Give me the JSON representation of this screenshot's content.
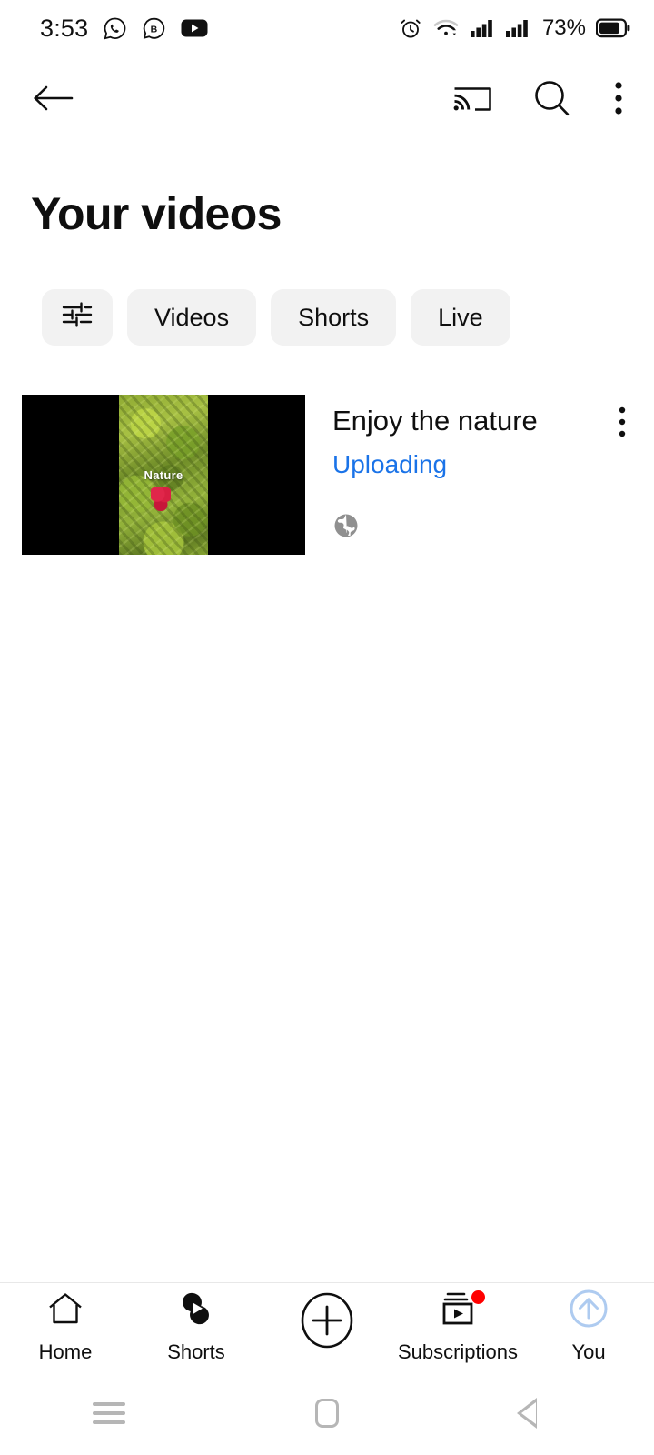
{
  "status_bar": {
    "time": "3:53",
    "left_icons": [
      "whatsapp-icon",
      "b-messenger-icon",
      "youtube-icon"
    ],
    "right_icons": [
      "alarm-icon",
      "wifi-icon",
      "signal-1-icon",
      "signal-2-icon"
    ],
    "battery_percent": "73%"
  },
  "header": {
    "back_icon": "back-arrow-icon",
    "cast_icon": "cast-icon",
    "search_icon": "search-icon",
    "overflow_icon": "more-vertical-icon",
    "title": "Your videos"
  },
  "filters": {
    "filter_icon": "tune-sliders-icon",
    "chips": [
      {
        "label": "Videos",
        "selected": false
      },
      {
        "label": "Shorts",
        "selected": false
      },
      {
        "label": "Live",
        "selected": false
      }
    ]
  },
  "videos": [
    {
      "title": "Enjoy the nature",
      "status": "Uploading",
      "status_color": "#1a73e8",
      "visibility": "public",
      "visibility_icon": "globe-icon",
      "thumbnail_overlay_text": "Nature",
      "menu_icon": "more-vertical-icon"
    }
  ],
  "bottom_nav": [
    {
      "label": "Home",
      "icon": "home-icon",
      "badge": false,
      "active": false
    },
    {
      "label": "Shorts",
      "icon": "shorts-icon",
      "badge": false,
      "active": false
    },
    {
      "label": "",
      "icon": "create-plus-icon",
      "badge": false,
      "active": false
    },
    {
      "label": "Subscriptions",
      "icon": "subscriptions-icon",
      "badge": true,
      "active": false
    },
    {
      "label": "You",
      "icon": "upload-progress-icon",
      "badge": false,
      "active": true
    }
  ],
  "android_nav": {
    "recents": "recents-icon",
    "home": "home-square-icon",
    "back": "back-triangle-icon"
  },
  "colors": {
    "accent_blue": "#1a73e8",
    "badge_red": "#ff0000",
    "chip_bg": "#f2f2f2",
    "text_primary": "#0f0f0f",
    "nav_gray": "#b6b6b6"
  }
}
